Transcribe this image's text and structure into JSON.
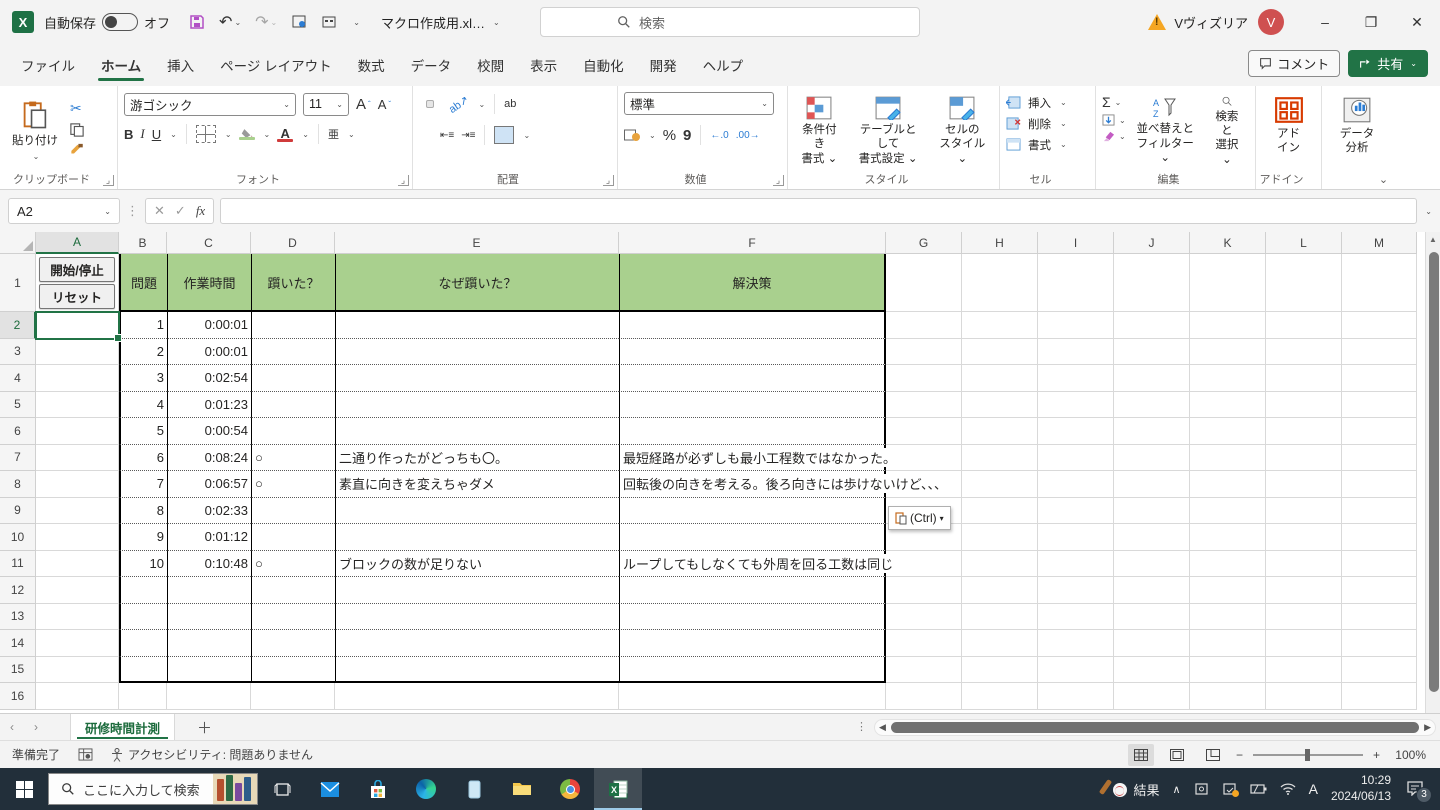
{
  "title_bar": {
    "app": "Excel",
    "autosave_label": "自動保存",
    "autosave_state": "オフ",
    "doc_title": "マクロ作成用.xl…",
    "search_placeholder": "検索",
    "account_name": "Vヴィズリア",
    "avatar_initial": "V",
    "window_buttons": {
      "minimize": "–",
      "restore": "❐",
      "close": "✕"
    }
  },
  "ribbon": {
    "tabs": [
      {
        "label": "ファイル",
        "active": false
      },
      {
        "label": "ホーム",
        "active": true
      },
      {
        "label": "挿入",
        "active": false
      },
      {
        "label": "ページ レイアウト",
        "active": false
      },
      {
        "label": "数式",
        "active": false
      },
      {
        "label": "データ",
        "active": false
      },
      {
        "label": "校閲",
        "active": false
      },
      {
        "label": "表示",
        "active": false
      },
      {
        "label": "自動化",
        "active": false
      },
      {
        "label": "開発",
        "active": false
      },
      {
        "label": "ヘルプ",
        "active": false
      }
    ],
    "comment_label": "コメント",
    "share_label": "共有",
    "clipboard": {
      "paste": "貼り付け",
      "group": "クリップボード"
    },
    "font": {
      "name": "游ゴシック",
      "size": "11",
      "bold": "B",
      "italic": "I",
      "underline": "U",
      "phonetic": "亜",
      "group": "フォント"
    },
    "alignment": {
      "wrap": "ab",
      "group": "配置"
    },
    "number": {
      "format": "標準",
      "percent": "%",
      "comma": "9",
      "inc_dec": "←.0",
      "dec_dec": ".00→",
      "group": "数値"
    },
    "styles": {
      "conditional": "条件付き\n書式 ⌄",
      "table": "テーブルとして\n書式設定 ⌄",
      "cellstyles": "セルの\nスタイル ⌄",
      "group": "スタイル"
    },
    "cells": {
      "insert": "挿入",
      "delete": "削除",
      "format": "書式",
      "group": "セル"
    },
    "editing": {
      "autosum": "Σ",
      "sort": "並べ替えと\nフィルター ⌄",
      "find": "検索と\n選択 ⌄",
      "group": "編集"
    },
    "addins": {
      "addins": "アド\nイン",
      "analysis": "データ\n分析",
      "group": "アドイン"
    }
  },
  "formula_bar": {
    "name_box": "A2",
    "fx": "fx",
    "formula_value": ""
  },
  "sheet": {
    "columns": [
      "A",
      "B",
      "C",
      "D",
      "E",
      "F",
      "G",
      "H",
      "I",
      "J",
      "K",
      "L",
      "M"
    ],
    "selected_cell": "A2",
    "selected_column": "A",
    "selected_row": "2",
    "row_count": 16,
    "control_buttons": [
      "開始/停止",
      "リセット"
    ],
    "header_fill": "#a9d08e",
    "table_headers": [
      "問題",
      "作業時間",
      "躓いた？",
      "なぜ躓いた？",
      "解決策"
    ],
    "rows": [
      {
        "problem": "1",
        "time": "0:00:01",
        "stumbled": "",
        "reason": "",
        "solution": ""
      },
      {
        "problem": "2",
        "time": "0:00:01",
        "stumbled": "",
        "reason": "",
        "solution": ""
      },
      {
        "problem": "3",
        "time": "0:02:54",
        "stumbled": "",
        "reason": "",
        "solution": ""
      },
      {
        "problem": "4",
        "time": "0:01:23",
        "stumbled": "",
        "reason": "",
        "solution": ""
      },
      {
        "problem": "5",
        "time": "0:00:54",
        "stumbled": "",
        "reason": "",
        "solution": ""
      },
      {
        "problem": "6",
        "time": "0:08:24",
        "stumbled": "○",
        "reason": "二通り作ったがどっちも〇。",
        "solution": "最短経路が必ずしも最小工程数ではなかった。"
      },
      {
        "problem": "7",
        "time": "0:06:57",
        "stumbled": "○",
        "reason": "素直に向きを変えちゃダメ",
        "solution": "回転後の向きを考える。後ろ向きには歩けないけど、、、"
      },
      {
        "problem": "8",
        "time": "0:02:33",
        "stumbled": "",
        "reason": "",
        "solution": ""
      },
      {
        "problem": "9",
        "time": "0:01:12",
        "stumbled": "",
        "reason": "",
        "solution": ""
      },
      {
        "problem": "10",
        "time": "0:10:48",
        "stumbled": "○",
        "reason": "ブロックの数が足りない",
        "solution": "ループしてもしなくても外周を回る工数は同じ"
      }
    ],
    "paste_options_label": "(Ctrl)"
  },
  "sheet_tabs": {
    "nav_prev": "‹",
    "nav_next": "›",
    "active_tab": "研修時間計測",
    "add": "＋"
  },
  "status_bar": {
    "ready": "準備完了",
    "accessibility": "アクセシビリティ: 問題ありません",
    "zoom_level": "100%",
    "zoom_minus": "−",
    "zoom_plus": "+"
  },
  "taskbar": {
    "search_placeholder": "ここに入力して検索",
    "news_label": "結果",
    "ime_indicator": "A",
    "time": "10:29",
    "date": "2024/06/13",
    "notification_count": "3"
  },
  "colors": {
    "excel_green": "#217346",
    "header_green": "#a9d08e",
    "avatar_red": "#cf5050",
    "taskbar": "#222f3a"
  }
}
